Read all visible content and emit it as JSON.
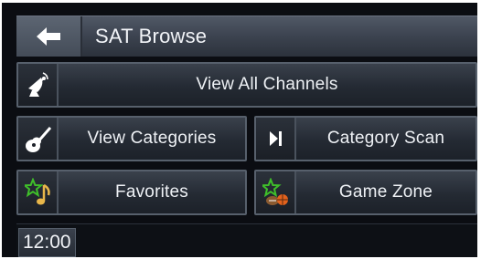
{
  "header": {
    "back_icon": "back-arrow-icon",
    "title": "SAT Browse"
  },
  "menu": {
    "view_all_channels": {
      "label": "View All Channels",
      "icon": "satellite-dish-icon"
    },
    "view_categories": {
      "label": "View Categories",
      "icon": "guitar-icon"
    },
    "category_scan": {
      "label": "Category Scan",
      "icon": "skip-next-icon"
    },
    "favorites": {
      "label": "Favorites",
      "icon": "star-note-icon"
    },
    "game_zone": {
      "label": "Game Zone",
      "icon": "sports-balls-icon"
    }
  },
  "status": {
    "clock": "12:00"
  },
  "colors": {
    "background": "#0b0d12",
    "button": "#242a33",
    "text": "#eef1f5",
    "icon_green": "#3fbf2a",
    "icon_orange": "#e2621d"
  }
}
